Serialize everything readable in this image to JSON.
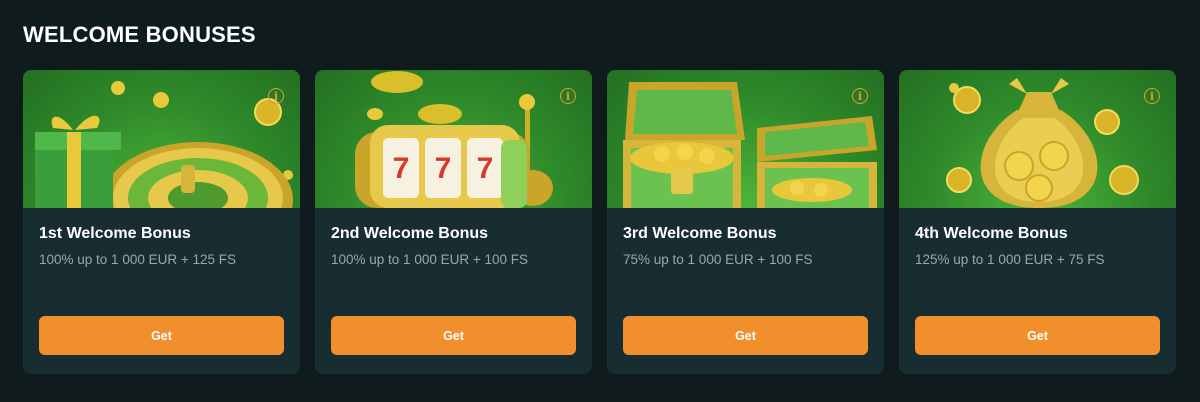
{
  "section": {
    "title": "WELCOME BONUSES"
  },
  "colors": {
    "accent": "#f18f2c",
    "info": "#e39a31",
    "card_bg": "#182d31",
    "page_bg": "#0f1b1d"
  },
  "cards": [
    {
      "title": "1st Welcome Bonus",
      "description": "100% up to 1 000 EUR + 125 FS",
      "button_label": "Get",
      "image_icon": "gift-roulette-icon"
    },
    {
      "title": "2nd Welcome Bonus",
      "description": "100% up to 1 000 EUR + 100 FS",
      "button_label": "Get",
      "image_icon": "slot-machine-icon"
    },
    {
      "title": "3rd Welcome Bonus",
      "description": "75% up to 1 000 EUR + 100 FS",
      "button_label": "Get",
      "image_icon": "treasure-chest-icon"
    },
    {
      "title": "4th Welcome Bonus",
      "description": "125% up to 1 000 EUR + 75 FS",
      "button_label": "Get",
      "image_icon": "money-bag-icon"
    }
  ]
}
